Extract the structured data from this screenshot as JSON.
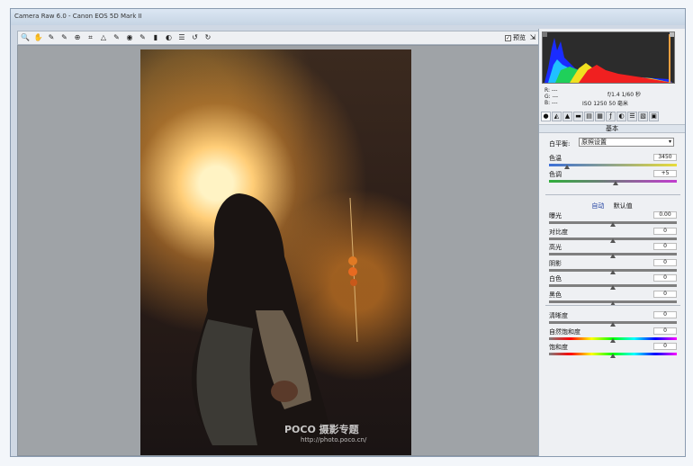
{
  "window": {
    "title": "Camera Raw 6.0 - Canon EOS 5D Mark II"
  },
  "toolbar": {
    "tools": [
      {
        "name": "zoom-tool",
        "glyph": "🔍"
      },
      {
        "name": "hand-tool",
        "glyph": "✋"
      },
      {
        "name": "white-balance-tool",
        "glyph": "✎"
      },
      {
        "name": "color-sampler-tool",
        "glyph": "✎"
      },
      {
        "name": "targeted-adjustment-tool",
        "glyph": "⊕"
      },
      {
        "name": "crop-tool",
        "glyph": "⌗"
      },
      {
        "name": "straighten-tool",
        "glyph": "△"
      },
      {
        "name": "spot-removal-tool",
        "glyph": "✎"
      },
      {
        "name": "red-eye-tool",
        "glyph": "◉"
      },
      {
        "name": "adjustment-brush-tool",
        "glyph": "✎"
      },
      {
        "name": "graduated-filter-tool",
        "glyph": "▮"
      },
      {
        "name": "open-preferences-tool",
        "glyph": "◐"
      },
      {
        "name": "preferences-tool",
        "glyph": "☰"
      },
      {
        "name": "rotate-ccw-tool",
        "glyph": "↺"
      },
      {
        "name": "rotate-cw-tool",
        "glyph": "↻"
      }
    ],
    "preview_label": "预览",
    "preview_checked": "✓",
    "fullscreen_glyph": "⇲"
  },
  "photo": {
    "watermark": "POCO 摄影专题",
    "watermark_url": "http://photo.poco.cn/"
  },
  "histogram_readout": {
    "r": "R: ---",
    "g": "G: ---",
    "b": "B: ---",
    "aperture_shutter": "f/1.4    1/60 秒",
    "iso_lens": "ISO 1250    50 毫米"
  },
  "panel_tabs": [
    "●",
    "◭",
    "▲",
    "▬",
    "▤",
    "▦",
    "ƒ",
    "◐",
    "☰",
    "▧",
    "▣"
  ],
  "basic": {
    "section_title": "基本",
    "white_balance_label": "白平衡:",
    "white_balance_value": "原照设置",
    "select_arrow": "▾",
    "auto_label": "自动",
    "default_label": "默认值",
    "sliders_top": [
      {
        "name": "temperature",
        "label": "色温",
        "value": "3450",
        "pos": 0.14,
        "track": "temp"
      },
      {
        "name": "tint",
        "label": "色调",
        "value": "+5",
        "pos": 0.52,
        "track": "tint"
      }
    ],
    "sliders_tone": [
      {
        "name": "exposure",
        "label": "曝光",
        "value": "0.00",
        "pos": 0.5,
        "track": "gray"
      },
      {
        "name": "contrast",
        "label": "对比度",
        "value": "0",
        "pos": 0.5,
        "track": "gray"
      },
      {
        "name": "highlights",
        "label": "高光",
        "value": "0",
        "pos": 0.5,
        "track": "gray"
      },
      {
        "name": "shadows",
        "label": "阴影",
        "value": "0",
        "pos": 0.5,
        "track": "gray"
      },
      {
        "name": "whites",
        "label": "白色",
        "value": "0",
        "pos": 0.5,
        "track": "gray"
      },
      {
        "name": "blacks",
        "label": "黑色",
        "value": "0",
        "pos": 0.5,
        "track": "gray"
      }
    ],
    "sliders_presence": [
      {
        "name": "clarity",
        "label": "清晰度",
        "value": "0",
        "pos": 0.5,
        "track": "gray"
      },
      {
        "name": "vibrance",
        "label": "自然饱和度",
        "value": "0",
        "pos": 0.5,
        "track": "sat"
      },
      {
        "name": "saturation",
        "label": "饱和度",
        "value": "0",
        "pos": 0.5,
        "track": "sat"
      }
    ]
  },
  "colors": {
    "accent": "#2040a0",
    "track_gray": "#7f7f7f",
    "track_temp_start": "#3b6fd8",
    "track_temp_end": "#e8dc3a",
    "track_tint_start": "#2fae3a",
    "track_tint_end": "#c23ccf"
  }
}
